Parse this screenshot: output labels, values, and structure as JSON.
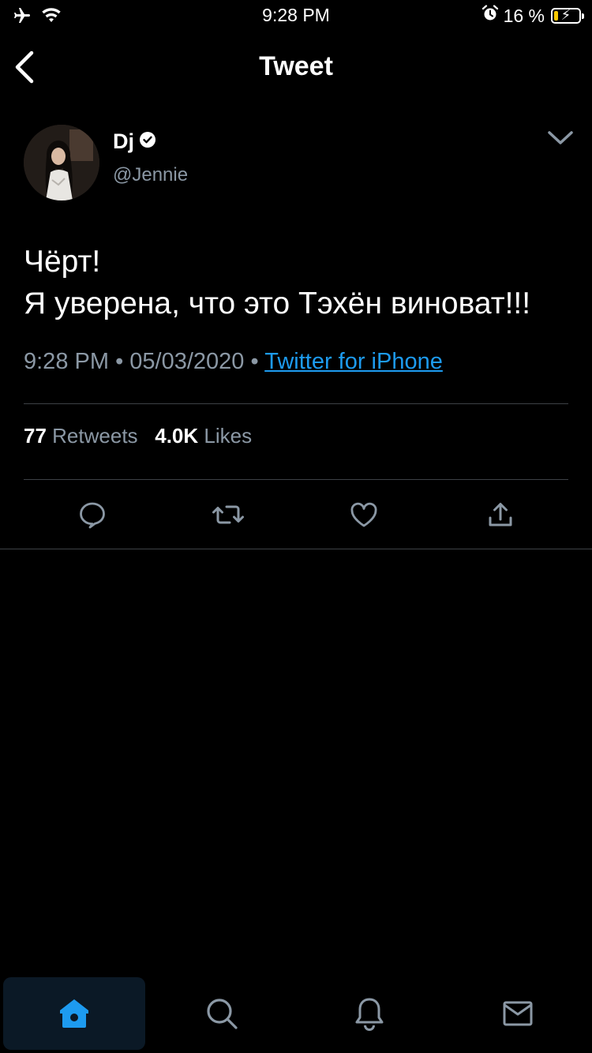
{
  "status_bar": {
    "time": "9:28 PM",
    "battery_text": "16 %",
    "battery_level": 0.16,
    "battery_color": "#f7c800"
  },
  "header": {
    "title": "Tweet",
    "back_icon": "chevron-left-icon"
  },
  "tweet": {
    "author": {
      "display_name": "Dj",
      "username": "@Jennie",
      "verified": true
    },
    "text_lines": [
      "Чёрт!",
      "Я уверена, что это Тэхён виноват!!!"
    ],
    "time": "9:28 PM",
    "separator": "•",
    "date": "05/03/2020",
    "source": "Twitter for iPhone",
    "stats": {
      "retweets_count": "77",
      "retweets_label": "Retweets",
      "likes_count": "4.0K",
      "likes_label": "Likes"
    },
    "actions": [
      "reply-icon",
      "retweet-icon",
      "like-icon",
      "share-icon"
    ]
  },
  "tab_bar": {
    "tabs": [
      {
        "icon": "home-icon",
        "active": true
      },
      {
        "icon": "search-icon",
        "active": false
      },
      {
        "icon": "notifications-icon",
        "active": false
      },
      {
        "icon": "messages-icon",
        "active": false
      }
    ],
    "active_color": "#1d9bf0",
    "inactive_color": "#8b98a5"
  },
  "colors": {
    "background": "#000000",
    "text_primary": "#ffffff",
    "text_secondary": "#8b98a5",
    "link": "#1d9bf0",
    "divider": "#3d4146"
  }
}
